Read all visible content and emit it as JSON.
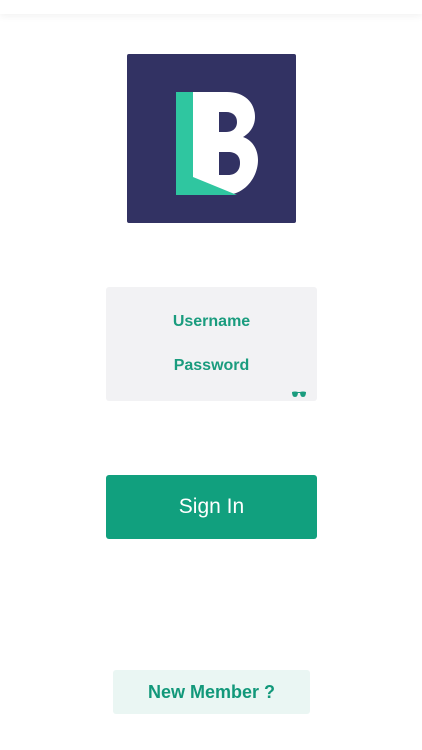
{
  "colors": {
    "brand_navy": "#323263",
    "brand_teal": "#2fc6a0",
    "accent_green": "#11a07e",
    "field_bg": "#f2f2f4",
    "secondary_bg": "#eaf6f3"
  },
  "logo": {
    "icon": "letter-b-logo"
  },
  "login": {
    "username_placeholder": "Username",
    "password_placeholder": "Password",
    "reveal_icon": "eye-icon"
  },
  "actions": {
    "signin_label": "Sign In",
    "new_member_label": "New Member ?"
  }
}
